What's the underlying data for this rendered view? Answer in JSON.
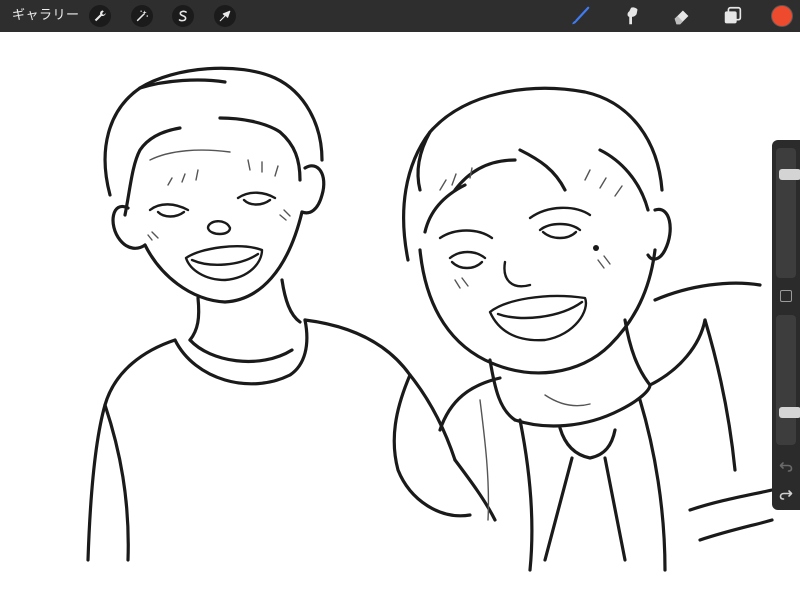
{
  "topbar": {
    "gallery_label": "ギャラリー",
    "left_tools": [
      {
        "name": "actions",
        "icon": "wrench-icon"
      },
      {
        "name": "adjustments",
        "icon": "magic-wand-icon"
      },
      {
        "name": "selection",
        "icon": "selection-s-icon"
      },
      {
        "name": "transform",
        "icon": "arrow-cursor-icon"
      }
    ],
    "right_tools": [
      {
        "name": "brush",
        "icon": "brush-icon",
        "active": true
      },
      {
        "name": "smudge",
        "icon": "smudge-icon",
        "active": false
      },
      {
        "name": "eraser",
        "icon": "eraser-icon",
        "active": false
      },
      {
        "name": "layers",
        "icon": "layers-icon",
        "active": false
      }
    ],
    "current_color": "#ee4a2d"
  },
  "sidebar": {
    "brush_size_level": 0.82,
    "brush_opacity_level": 0.23,
    "modify_icon": "square-modify-icon",
    "undo_icon": "undo-icon",
    "redo_icon": "redo-icon"
  },
  "colors": {
    "toolbar_bg": "#2e2e2e",
    "active_tool": "#3f7bf3",
    "canvas_bg": "#ffffff",
    "ink": "#1a1a1a"
  },
  "canvas": {
    "description_icon": "sketch-drawing"
  }
}
